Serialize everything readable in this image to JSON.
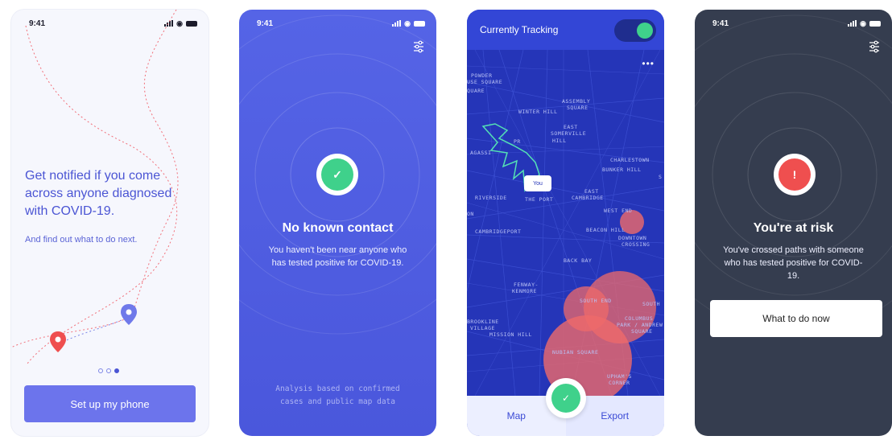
{
  "status_time": "9:41",
  "onboarding": {
    "headline": "Get notified if you come across anyone diagnosed with COVID-19.",
    "subline": "And find out what to do next.",
    "setup_button": "Set up my phone",
    "page_indicator": {
      "count": 3,
      "active": 3
    }
  },
  "no_contact": {
    "title": "No known contact",
    "body": "You haven't been near anyone who has tested positive for COVID-19.",
    "footnote_line1": "Analysis based on confirmed",
    "footnote_line2": "cases and public map data",
    "icon": "check-icon",
    "accent": "#3fd18b"
  },
  "tracking": {
    "header": "Currently Tracking",
    "toggle_on": true,
    "you_label": "You",
    "map_tab": "Map",
    "export_tab": "Export",
    "labels": {
      "powder": "POWDER",
      "house_square": "USE SQUARE",
      "square": "QUARE",
      "assembly": "ASSEMBLY",
      "assembly_sq": "SQUARE",
      "winter_hill": "WINTER HILL",
      "east": "EAST",
      "somerville": "SOMERVILLE",
      "prospect": "PR",
      "hill": "HILL",
      "agassiz": "AGASSI",
      "charlestown": "CHARLESTOWN",
      "bunker": "BUNKER HILL",
      "s": "S",
      "riverside": "RIVERSIDE",
      "the_port": "THE PORT",
      "east2": "EAST",
      "cambridge": "CAMBRIDGE",
      "on": "ON",
      "west_end": "WEST END",
      "cambridgeport": "CAMBRIDGEPORT",
      "beacon": "BEACON HILL",
      "downtown": "DOWNTOWN",
      "crossing": "CROSSING",
      "backbay": "BACK BAY",
      "fenway": "FENWAY-",
      "kenmore": "KENMORE",
      "south": "SOUTH",
      "south_end": "SOUTH END",
      "columbus": "COLUMBUS",
      "park": "PARK / ANDREW",
      "square2": "SQUARE",
      "south2": "SOUTH",
      "brookline": "BROOKLINE",
      "village": "VILLAGE",
      "mission": "MISSION HILL",
      "nubian": "NUBIAN SQUARE",
      "uphams": "UPHAM'S",
      "corner": "CORNER"
    }
  },
  "at_risk": {
    "title": "You're at risk",
    "body": "You've crossed paths with someone who has tested positive for COVID-19.",
    "button": "What to do now",
    "icon": "alert-icon",
    "accent": "#ef4f4f"
  }
}
